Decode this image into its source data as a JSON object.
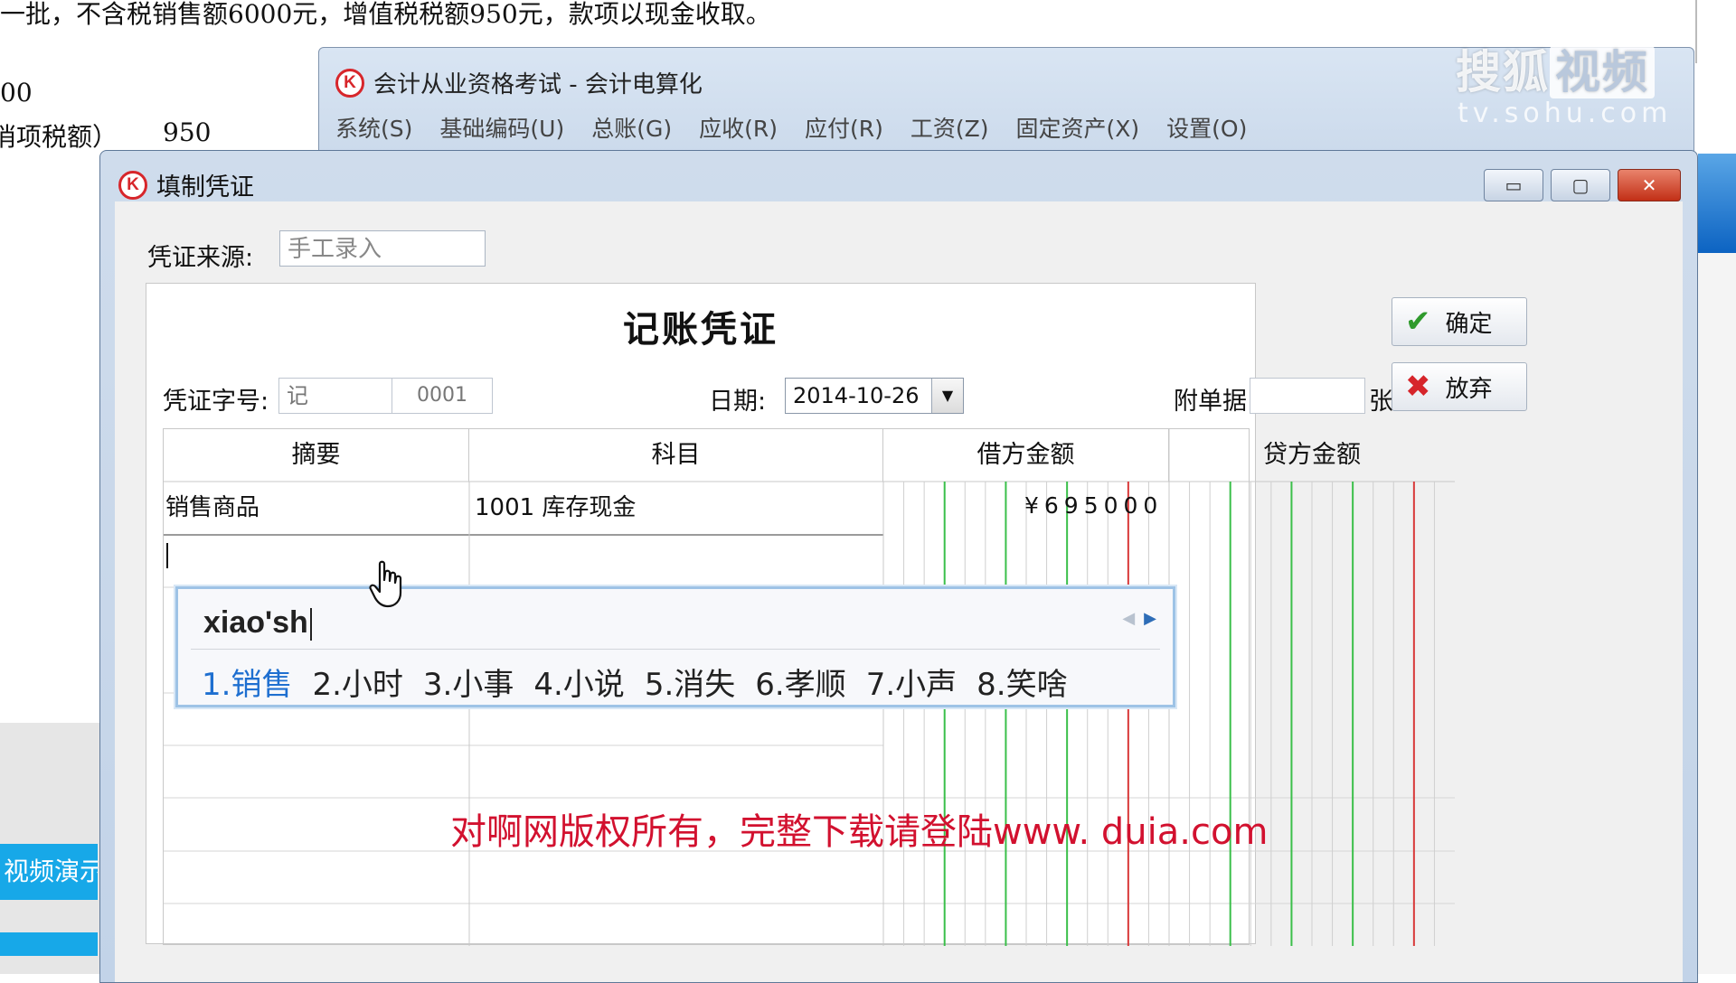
{
  "background_doc": {
    "line1": "一批，不含税销售额6000元，增值税税额950元，款项以现金收取。",
    "line2": "00",
    "line3_label": "消项税额）",
    "line3_value": "950",
    "left_panel_label": "视频演示"
  },
  "watermark": {
    "logo_part1": "搜狐",
    "logo_part2": "视频",
    "url": "tv.sohu.com",
    "copyright": "对啊网版权所有，完整下载请登陆www. duia.com"
  },
  "app_window": {
    "logo_letter": "K",
    "title": "会计从业资格考试 - 会计电算化",
    "menu": [
      "系统(S)",
      "基础编码(U)",
      "总账(G)",
      "应收(R)",
      "应付(R)",
      "工资(Z)",
      "固定资产(X)",
      "设置(O)"
    ]
  },
  "dialog": {
    "title": "填制凭证",
    "source_label": "凭证来源:",
    "source_value": "手工录入",
    "voucher_title": "记账凭证",
    "voucher_no_label": "凭证字号:",
    "voucher_word": "记",
    "voucher_number": "0001",
    "date_label": "日期:",
    "date_value": "2014-10-26",
    "attach_label": "附单据:",
    "attach_value": "",
    "attach_unit": "张",
    "columns": [
      "摘要",
      "科目",
      "借方金额",
      "贷方金额"
    ],
    "rows": [
      {
        "summary": "销售商品",
        "account": "1001  库存现金",
        "debit": "¥695000",
        "credit": ""
      },
      {
        "summary": "",
        "account": "",
        "debit": "",
        "credit": ""
      }
    ],
    "ok_label": "确定",
    "cancel_label": "放弃"
  },
  "ime": {
    "input": "xiao'sh",
    "candidates": [
      "1.销售",
      "2.小时",
      "3.小事",
      "4.小说",
      "5.消失",
      "6.孝顺",
      "7.小声",
      "8.笑啥"
    ]
  }
}
